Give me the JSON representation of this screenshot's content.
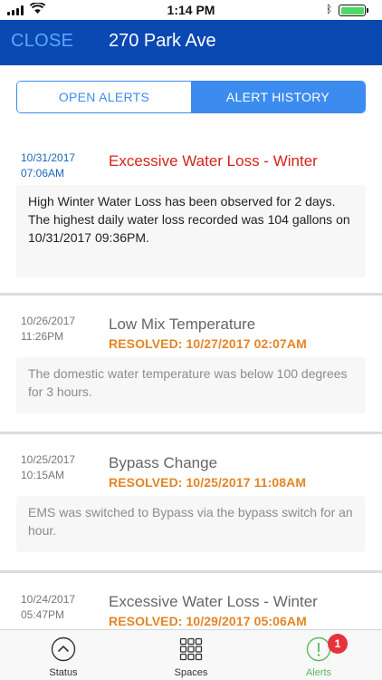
{
  "status_bar": {
    "time": "1:14 PM"
  },
  "nav": {
    "close_label": "CLOSE",
    "title": "270 Park Ave"
  },
  "segments": {
    "open_label": "OPEN ALERTS",
    "history_label": "ALERT HISTORY",
    "selected": "ALERT HISTORY"
  },
  "alerts": [
    {
      "date": "10/31/2017",
      "time": "07:06AM",
      "title": "Excessive Water Loss - Winter",
      "resolved": "",
      "message": [
        "High Winter Water Loss has been observed for 2 days.",
        "The highest daily water loss recorded was 104 gallons on 10/31/2017 09:36PM."
      ]
    },
    {
      "date": "10/26/2017",
      "time": "11:26PM",
      "title": "Low Mix Temperature",
      "resolved": "RESOLVED: 10/27/2017 02:07AM",
      "message": [
        "The domestic water temperature was below 100 degrees for 3 hours."
      ]
    },
    {
      "date": "10/25/2017",
      "time": "10:15AM",
      "title": "Bypass Change",
      "resolved": "RESOLVED: 10/25/2017 11:08AM",
      "message": [
        "EMS was switched to Bypass via the bypass switch for an hour."
      ]
    },
    {
      "date": "10/24/2017",
      "time": "05:47PM",
      "title": "Excessive Water Loss - Winter",
      "resolved": "RESOLVED: 10/29/2017 05:06AM",
      "message": []
    }
  ],
  "tabs": [
    {
      "label": "Status",
      "icon": "status-up-icon"
    },
    {
      "label": "Spaces",
      "icon": "grid-icon"
    },
    {
      "label": "Alerts",
      "icon": "alert-icon",
      "badge": "1",
      "selected": true
    }
  ],
  "colors": {
    "nav_bg": "#0a48b2",
    "close_text": "#5aa8ff",
    "segment_accent": "#3c8cf0",
    "active_title": "#d4241b",
    "active_date": "#1f66b8",
    "resolved": "#e58524",
    "selected_tab": "#5cb85c",
    "badge": "#e63339"
  }
}
